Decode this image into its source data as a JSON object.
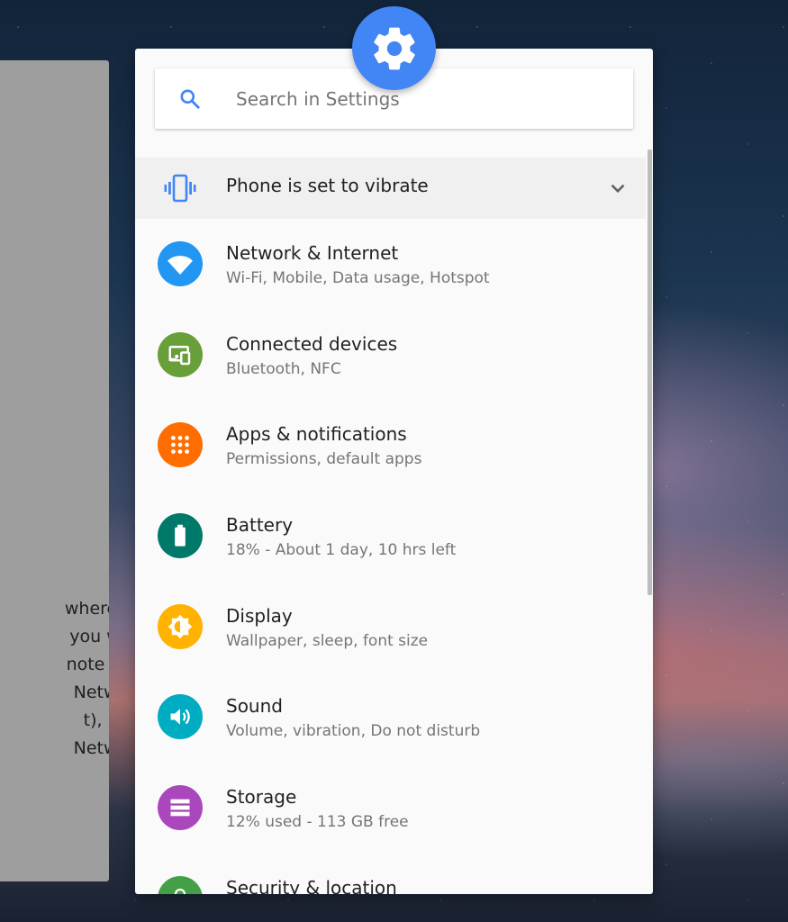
{
  "background_card": {
    "lines": [
      "wherever",
      "you wish",
      "note that",
      "Network",
      "t), may",
      "Network"
    ]
  },
  "search": {
    "placeholder": "Search in Settings"
  },
  "condition": {
    "label": "Phone is set to vibrate"
  },
  "settings": [
    {
      "title": "Network & Internet",
      "subtitle": "Wi-Fi, Mobile, Data usage, Hotspot",
      "icon": "wifi-icon",
      "color": "#2196f3"
    },
    {
      "title": "Connected devices",
      "subtitle": "Bluetooth, NFC",
      "icon": "devices-icon",
      "color": "#689f38"
    },
    {
      "title": "Apps & notifications",
      "subtitle": "Permissions, default apps",
      "icon": "apps-icon",
      "color": "#ff6d00"
    },
    {
      "title": "Battery",
      "subtitle": "18% - About 1 day, 10 hrs left",
      "icon": "battery-icon",
      "color": "#00796b"
    },
    {
      "title": "Display",
      "subtitle": "Wallpaper, sleep, font size",
      "icon": "brightness-icon",
      "color": "#ffb300"
    },
    {
      "title": "Sound",
      "subtitle": "Volume, vibration, Do not disturb",
      "icon": "volume-icon",
      "color": "#00acc1"
    },
    {
      "title": "Storage",
      "subtitle": "12% used - 113 GB free",
      "icon": "storage-icon",
      "color": "#ab47bc"
    },
    {
      "title": "Security & location",
      "subtitle": "",
      "icon": "lock-icon",
      "color": "#43a047"
    }
  ],
  "colors": {
    "accent": "#4285f4",
    "panel": "#fafafa"
  }
}
